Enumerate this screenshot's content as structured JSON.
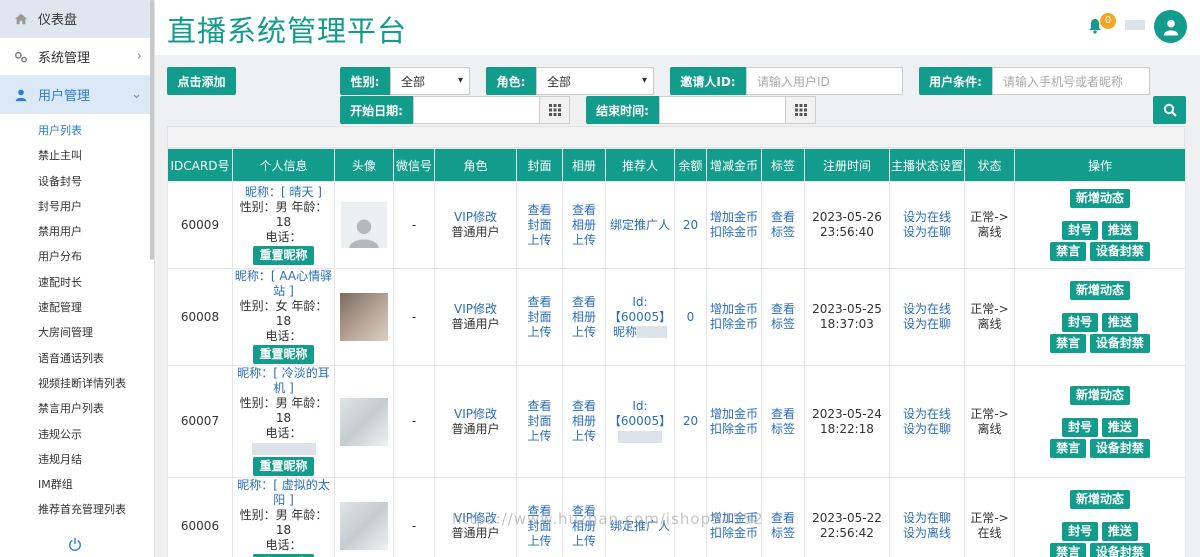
{
  "sidebar": {
    "dashboard": "仪表盘",
    "system": "系统管理",
    "users": "用户管理",
    "sub_items": [
      "用户列表",
      "禁止主叫",
      "设备封号",
      "封号用户",
      "禁用用户",
      "用户分布",
      "速配时长",
      "速配管理",
      "大房间管理",
      "语音通话列表",
      "视频挂断详情列表",
      "禁言用户列表",
      "违规公示",
      "违规月结",
      "IM群组",
      "推荐首充管理列表"
    ]
  },
  "header": {
    "title": "直播系统管理平台",
    "badge": "0"
  },
  "filters": {
    "add_button": "点击添加",
    "gender_label": "性别:",
    "gender_value": "全部",
    "role_label": "角色:",
    "role_value": "全部",
    "inviter_label": "邀请人ID:",
    "inviter_placeholder": "请输入用户ID",
    "cond_label": "用户条件:",
    "cond_placeholder": "请输入手机号或者昵称",
    "start_label": "开始日期:",
    "end_label": "结束时间:"
  },
  "table": {
    "headers": [
      "IDCARD号",
      "个人信息",
      "头像",
      "微信号",
      "角色",
      "封面",
      "相册",
      "推荐人",
      "余额",
      "增减金币",
      "标签",
      "注册时间",
      "主播状态设置",
      "状态",
      "操作"
    ],
    "rows": [
      {
        "id": "60009",
        "nick": "昵称：[ 晴天 ]",
        "gender_age": "性别：男  年龄：18",
        "phone": "电话：",
        "wechat": "-",
        "role_link": "VIP修改",
        "role": "普通用户",
        "cover": [
          "查看",
          "封面",
          "上传"
        ],
        "album": [
          "查看",
          "相册",
          "上传"
        ],
        "referrer": [
          "绑定推广人"
        ],
        "balance": "20",
        "coins": [
          "增加金币",
          "扣除金币"
        ],
        "tag": [
          "查看",
          "标签"
        ],
        "reg": [
          "2023-05-26",
          "23:56:40"
        ],
        "anchor": [
          "设为在线",
          "设为在聊"
        ],
        "status": [
          "正常->",
          "离线"
        ]
      },
      {
        "id": "60008",
        "nick": "昵称：[ AA心情驿站 ]",
        "gender_age": "性别：女  年龄：18",
        "phone": "电话：",
        "wechat": "-",
        "role_link": "VIP修改",
        "role": "普通用户",
        "cover": [
          "查看",
          "封面",
          "上传"
        ],
        "album": [
          "查看",
          "相册",
          "上传"
        ],
        "referrer": [
          "Id:",
          "【60005】",
          "昵称"
        ],
        "balance": "0",
        "coins": [
          "增加金币",
          "扣除金币"
        ],
        "tag": [
          "查看",
          "标签"
        ],
        "reg": [
          "2023-05-25",
          "18:37:03"
        ],
        "anchor": [
          "设为在线",
          "设为在聊"
        ],
        "status": [
          "正常->",
          "离线"
        ]
      },
      {
        "id": "60007",
        "nick": "昵称：[ 冷淡的耳机 ]",
        "gender_age": "性别：男  年龄：18",
        "phone": "电话：",
        "wechat": "-",
        "role_link": "VIP修改",
        "role": "普通用户",
        "cover": [
          "查看",
          "封面",
          "上传"
        ],
        "album": [
          "查看",
          "相册",
          "上传"
        ],
        "referrer": [
          "Id:",
          "【60005】",
          ""
        ],
        "balance": "20",
        "coins": [
          "增加金币",
          "扣除金币"
        ],
        "tag": [
          "查看",
          "标签"
        ],
        "reg": [
          "2023-05-24",
          "18:22:18"
        ],
        "anchor": [
          "设为在线",
          "设为在聊"
        ],
        "status": [
          "正常->",
          "离线"
        ]
      },
      {
        "id": "60006",
        "nick": "昵称：[ 虚拟的太阳 ]",
        "gender_age": "性别：男  年龄：18",
        "phone": "电话：",
        "wechat": "-",
        "role_link": "VIP修改",
        "role": "普通用户",
        "cover": [
          "查看",
          "封面",
          "上传"
        ],
        "album": [
          "查看",
          "相册",
          "上传"
        ],
        "referrer": [
          "绑定推广人"
        ],
        "balance": "",
        "coins": [
          "增加金币",
          "扣除金币"
        ],
        "tag": [
          "查看",
          "标签"
        ],
        "reg": [
          "2023-05-22",
          "22:56:42"
        ],
        "anchor": [
          "设为在聊",
          "设为离线"
        ],
        "status": [
          "正常->",
          "在线"
        ]
      }
    ],
    "reset_nick": "重置昵称",
    "op_new": "新增动态",
    "op_ban": "封号",
    "op_push": "推送",
    "op_mute": "禁言",
    "op_device": "设备封禁"
  },
  "watermark": "https://www.huzhan.com/ishop54152"
}
